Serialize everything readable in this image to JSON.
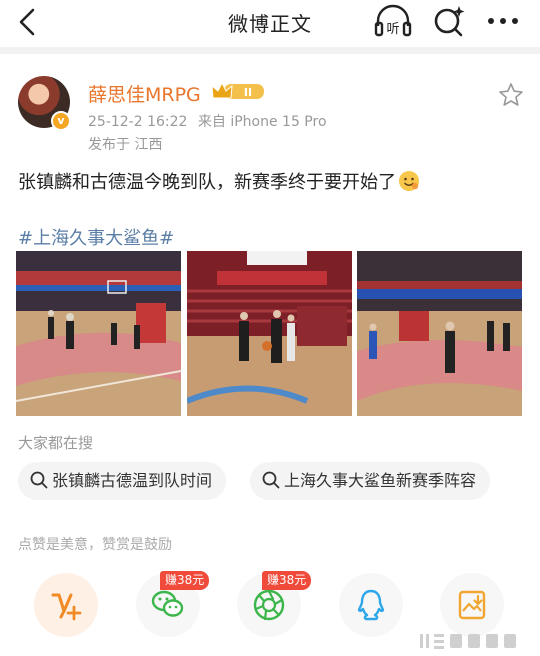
{
  "topbar": {
    "title": "微博正文",
    "listen_label": "听"
  },
  "post": {
    "username": "薛思佳MRPG",
    "timestamp": "25-12-2 16:22",
    "source": "来自 iPhone 15 Pro",
    "location": "发布于 江西",
    "text": "张镇麟和古德温今晚到队，新赛季终于要开始了",
    "hashtag": "#上海久事大鲨鱼#",
    "photos": [
      {
        "alt": "basketball-court-photo-1"
      },
      {
        "alt": "basketball-court-photo-2"
      },
      {
        "alt": "basketball-court-photo-3"
      }
    ]
  },
  "search_suggestions": {
    "title": "大家都在搜",
    "items": [
      "张镇麟古德温到队时间",
      "上海久事大鲨鱼新赛季阵容"
    ]
  },
  "praise_hint": "点赞是美意，赞赏是鼓励",
  "actions": [
    {
      "name": "reward",
      "icon": "v-plus-icon"
    },
    {
      "name": "wechat",
      "icon": "wechat-icon",
      "badge": "赚38元"
    },
    {
      "name": "moments",
      "icon": "moments-icon",
      "badge": "赚38元"
    },
    {
      "name": "qq",
      "icon": "qq-icon"
    },
    {
      "name": "save-image",
      "icon": "save-image-icon"
    }
  ],
  "colors": {
    "username": "#e8762c",
    "hashtag": "#5b7ea6",
    "earn_badge": "#f04a3a"
  }
}
